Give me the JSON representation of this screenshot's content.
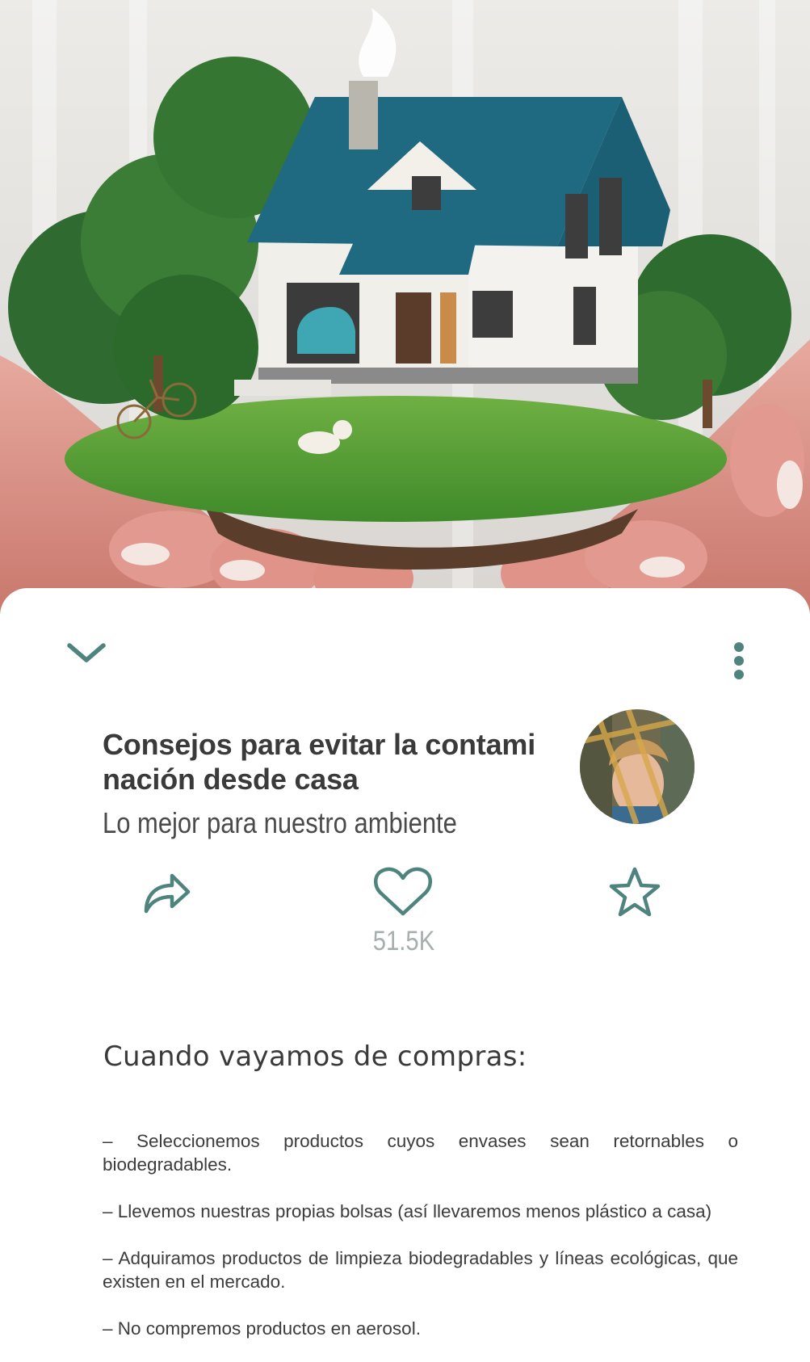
{
  "article": {
    "title": "Consejos para evitar la contami nación desde casa",
    "subtitle": "Lo mejor para nuestro ambiente"
  },
  "actions": {
    "like_count": "51.5K"
  },
  "content": {
    "heading": "Cuando vayamos de compras:",
    "tips": [
      "– Seleccionemos productos cuyos envases sean retornables o biodegradables.",
      "– Llevemos nuestras propias bolsas (así llevaremos menos plástico a casa)",
      "– Adquiramos productos de limpieza biodegradables y líneas ecológicas, que existen en el mercado.",
      "– No compremos productos en aerosol."
    ]
  },
  "icons": {
    "collapse": "chevron-down-icon",
    "more": "more-vertical-icon",
    "share": "share-icon",
    "like": "heart-icon",
    "favorite": "star-icon"
  },
  "colors": {
    "accent": "#4e847d",
    "text": "#3a3a3a",
    "muted": "#a7aeae"
  }
}
